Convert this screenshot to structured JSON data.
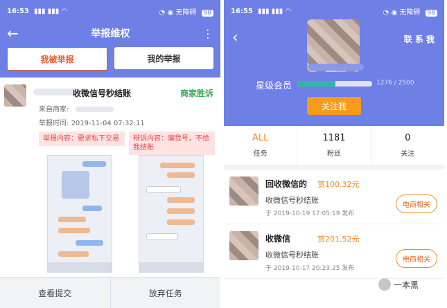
{
  "colors": {
    "primary": "#6e7fe6",
    "orange": "#f08b2a",
    "green": "#3ba85a",
    "danger": "#e24848"
  },
  "left": {
    "status": {
      "time": "16:53",
      "signal": "▮▮▮ ▮▮▮ ◠",
      "right": "◔ ◉ 无障碍",
      "battery": "98"
    },
    "header": {
      "title": "举报维权"
    },
    "tabs": [
      "我被举报",
      "我的举报"
    ],
    "report": {
      "title": "收微信号秒结账",
      "result": "商家胜诉",
      "merchant_label": "来自商家:",
      "time_label": "举报时间:",
      "time_value": "2019-11-04 07:32:11",
      "report_content": "举报内容：要求私下交易",
      "appeal_content": "辩诉内容：骗我号，不给我结账"
    },
    "bottom": {
      "view": "查看提交",
      "giveup": "放弃任务"
    }
  },
  "right": {
    "status": {
      "time": "16:55",
      "signal": "▮▮▮ ▮▮▮ ◠",
      "right": "◔ ◉ 无障碍",
      "battery": "98"
    },
    "header": {
      "right_label": "联 系 我"
    },
    "profile": {
      "member_label": "星级会员",
      "progress_text": "1276 / 2500",
      "progress_value": 1276,
      "progress_max": 2500,
      "follow_button": "关注我"
    },
    "stats": [
      {
        "value": "ALL",
        "label": "任务"
      },
      {
        "value": "1181",
        "label": "粉丝"
      },
      {
        "value": "0",
        "label": "关注"
      }
    ],
    "tasks": [
      {
        "title": "回收微信的",
        "reward": "赏100.32元",
        "subtitle": "收微信号秒结账",
        "meta": "于 2019-10-19 17:05:19 发布",
        "tag": "电商相关"
      },
      {
        "title": "收微信",
        "reward": "赏201.52元",
        "subtitle": "收微信号秒结账",
        "meta": "于 2019-10-17 20:23:25 发布",
        "tag": "电商相关"
      }
    ]
  },
  "watermark": {
    "text": "一本黑"
  }
}
